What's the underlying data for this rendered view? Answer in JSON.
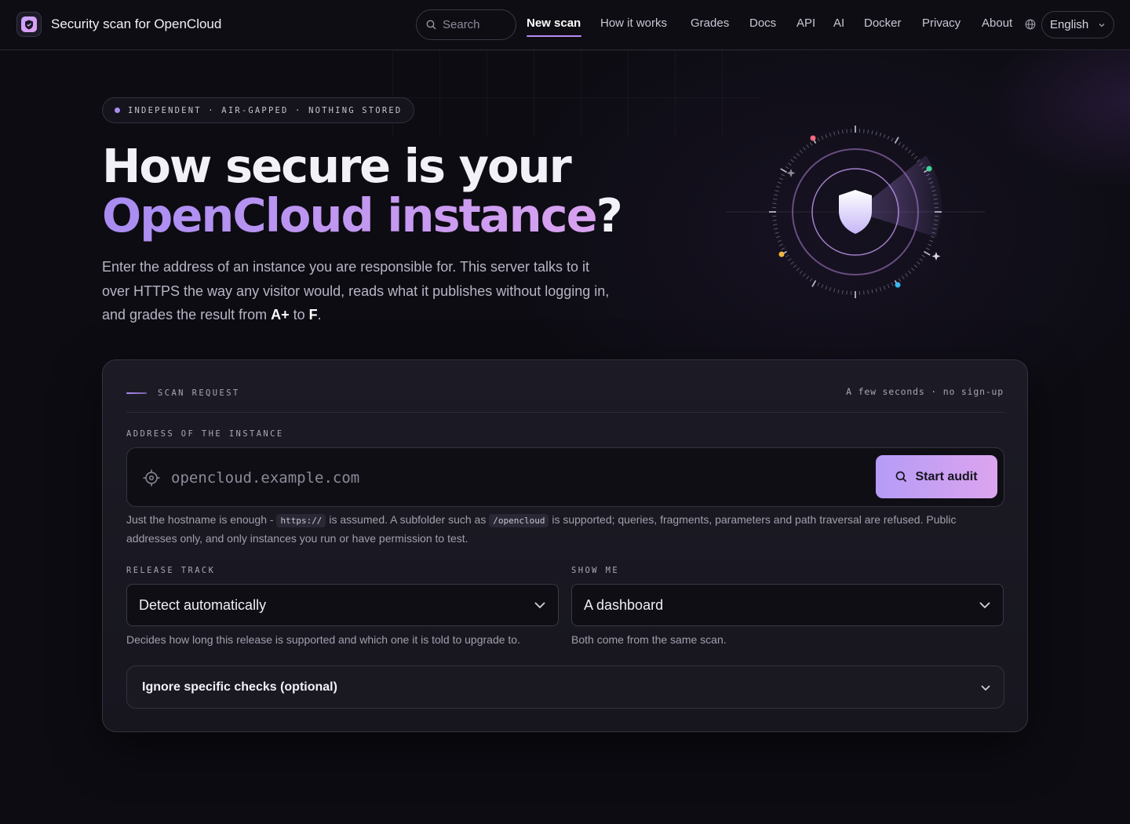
{
  "brand": {
    "name": "Security scan for OpenCloud",
    "icon": "shield-icon"
  },
  "nav": {
    "search_placeholder": "Search",
    "links": [
      {
        "label": "New scan",
        "active": true
      },
      {
        "label": "How it works"
      },
      {
        "label": "Grades"
      },
      {
        "label": "Docs"
      },
      {
        "label": "API"
      },
      {
        "label": "AI"
      },
      {
        "label": "Docker"
      },
      {
        "label": "Privacy"
      },
      {
        "label": "About"
      }
    ],
    "language": "English"
  },
  "hero": {
    "pill": "INDEPENDENT · AIR-GAPPED · NOTHING STORED",
    "title_line1": "How secure is your",
    "title_accent": "OpenCloud instance",
    "title_end": "?",
    "lead_text": "Enter the address of an instance you are responsible for. This server talks to it over HTTPS the way any visitor would, reads what it publishes without logging in, and grades the result from ",
    "grade_high": "A+",
    "lead_mid": " to ",
    "grade_low": "F",
    "lead_end": "."
  },
  "scan_card": {
    "heading": "SCAN REQUEST",
    "meta": "A few seconds · no sign-up",
    "address_label": "ADDRESS OF THE INSTANCE",
    "address_placeholder": "opencloud.example.com",
    "start_label": "Start audit",
    "help_1": "Just the hostname is enough - ",
    "help_code_1": "https://",
    "help_2": " is assumed. A subfolder such as ",
    "help_code_2": "/opencloud",
    "help_3": " is supported; queries, fragments, parameters and path traversal are refused. Public addresses only, and only instances you run or have permission to test.",
    "release_label": "RELEASE TRACK",
    "release_value": "Detect automatically",
    "release_help": "Decides how long this release is supported and which one it is told to upgrade to.",
    "show_label": "SHOW ME",
    "show_value": "A dashboard",
    "show_help": "Both come from the same scan.",
    "ignore_label": "Ignore specific checks (optional)"
  },
  "colors": {
    "background": "#0d0c13",
    "accent_start": "#a88cf2",
    "accent_end": "#dca4ee",
    "dot_red": "#f06a7e",
    "dot_green": "#3ed69a",
    "dot_yellow": "#f3b63f",
    "dot_blue": "#39b7f0"
  }
}
